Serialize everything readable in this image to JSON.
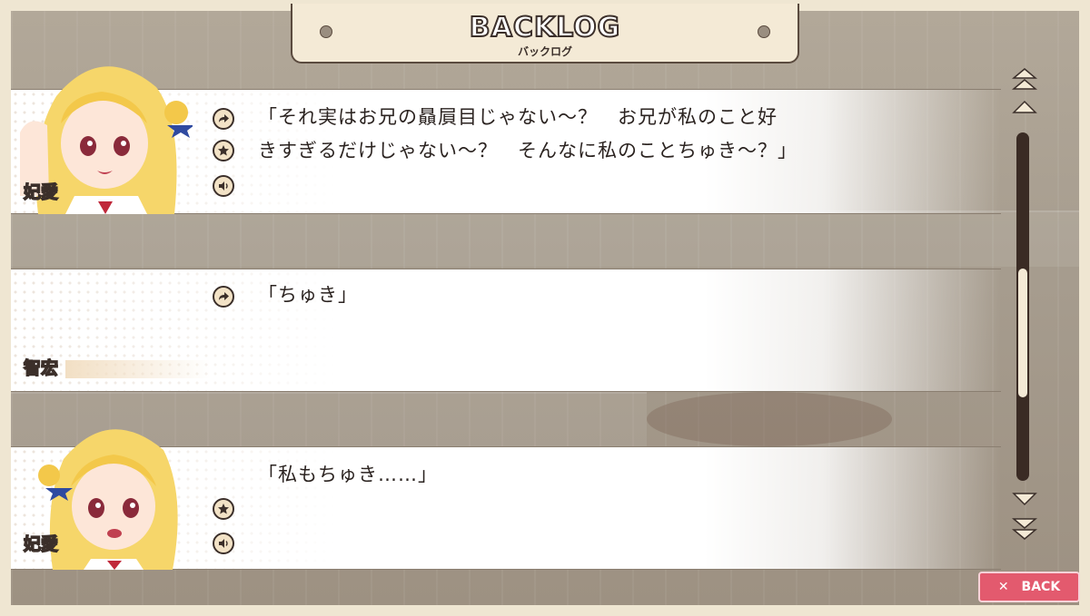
{
  "header": {
    "title": "BACKLOG",
    "subtitle": "バックログ"
  },
  "entries": [
    {
      "speaker": "妃愛",
      "lines": [
        "「それ実はお兄の贔屓目じゃない〜？　お兄が私のこと好",
        "きすぎるだけじゃない〜？　そんなに私のことちゅき〜？」"
      ]
    },
    {
      "speaker": "智宏",
      "lines": [
        "「ちゅき」"
      ]
    },
    {
      "speaker": "妃愛",
      "lines": [
        "「私もちゅき……」"
      ]
    }
  ],
  "scrollbar": {
    "position": 0.62
  },
  "back_button": {
    "label": "BACK",
    "icon": "close-icon"
  },
  "colors": {
    "back": "#e35a6e",
    "frame": "#efe6d2",
    "text": "#2b2320"
  }
}
